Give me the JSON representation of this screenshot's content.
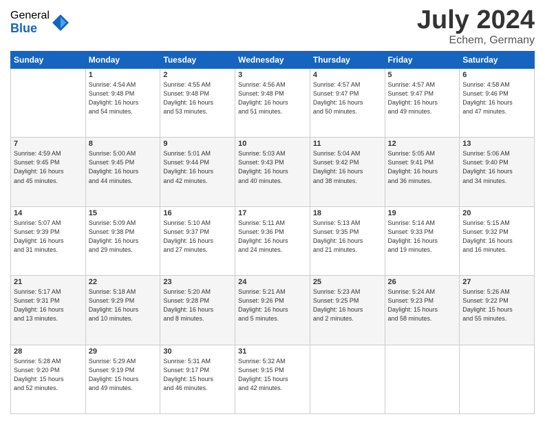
{
  "logo": {
    "general": "General",
    "blue": "Blue"
  },
  "title": {
    "month_year": "July 2024",
    "location": "Echem, Germany"
  },
  "headers": [
    "Sunday",
    "Monday",
    "Tuesday",
    "Wednesday",
    "Thursday",
    "Friday",
    "Saturday"
  ],
  "weeks": [
    [
      {
        "day": "",
        "info": ""
      },
      {
        "day": "1",
        "info": "Sunrise: 4:54 AM\nSunset: 9:48 PM\nDaylight: 16 hours\nand 54 minutes."
      },
      {
        "day": "2",
        "info": "Sunrise: 4:55 AM\nSunset: 9:48 PM\nDaylight: 16 hours\nand 53 minutes."
      },
      {
        "day": "3",
        "info": "Sunrise: 4:56 AM\nSunset: 9:48 PM\nDaylight: 16 hours\nand 51 minutes."
      },
      {
        "day": "4",
        "info": "Sunrise: 4:57 AM\nSunset: 9:47 PM\nDaylight: 16 hours\nand 50 minutes."
      },
      {
        "day": "5",
        "info": "Sunrise: 4:57 AM\nSunset: 9:47 PM\nDaylight: 16 hours\nand 49 minutes."
      },
      {
        "day": "6",
        "info": "Sunrise: 4:58 AM\nSunset: 9:46 PM\nDaylight: 16 hours\nand 47 minutes."
      }
    ],
    [
      {
        "day": "7",
        "info": "Sunrise: 4:59 AM\nSunset: 9:45 PM\nDaylight: 16 hours\nand 45 minutes."
      },
      {
        "day": "8",
        "info": "Sunrise: 5:00 AM\nSunset: 9:45 PM\nDaylight: 16 hours\nand 44 minutes."
      },
      {
        "day": "9",
        "info": "Sunrise: 5:01 AM\nSunset: 9:44 PM\nDaylight: 16 hours\nand 42 minutes."
      },
      {
        "day": "10",
        "info": "Sunrise: 5:03 AM\nSunset: 9:43 PM\nDaylight: 16 hours\nand 40 minutes."
      },
      {
        "day": "11",
        "info": "Sunrise: 5:04 AM\nSunset: 9:42 PM\nDaylight: 16 hours\nand 38 minutes."
      },
      {
        "day": "12",
        "info": "Sunrise: 5:05 AM\nSunset: 9:41 PM\nDaylight: 16 hours\nand 36 minutes."
      },
      {
        "day": "13",
        "info": "Sunrise: 5:06 AM\nSunset: 9:40 PM\nDaylight: 16 hours\nand 34 minutes."
      }
    ],
    [
      {
        "day": "14",
        "info": "Sunrise: 5:07 AM\nSunset: 9:39 PM\nDaylight: 16 hours\nand 31 minutes."
      },
      {
        "day": "15",
        "info": "Sunrise: 5:09 AM\nSunset: 9:38 PM\nDaylight: 16 hours\nand 29 minutes."
      },
      {
        "day": "16",
        "info": "Sunrise: 5:10 AM\nSunset: 9:37 PM\nDaylight: 16 hours\nand 27 minutes."
      },
      {
        "day": "17",
        "info": "Sunrise: 5:11 AM\nSunset: 9:36 PM\nDaylight: 16 hours\nand 24 minutes."
      },
      {
        "day": "18",
        "info": "Sunrise: 5:13 AM\nSunset: 9:35 PM\nDaylight: 16 hours\nand 21 minutes."
      },
      {
        "day": "19",
        "info": "Sunrise: 5:14 AM\nSunset: 9:33 PM\nDaylight: 16 hours\nand 19 minutes."
      },
      {
        "day": "20",
        "info": "Sunrise: 5:15 AM\nSunset: 9:32 PM\nDaylight: 16 hours\nand 16 minutes."
      }
    ],
    [
      {
        "day": "21",
        "info": "Sunrise: 5:17 AM\nSunset: 9:31 PM\nDaylight: 16 hours\nand 13 minutes."
      },
      {
        "day": "22",
        "info": "Sunrise: 5:18 AM\nSunset: 9:29 PM\nDaylight: 16 hours\nand 10 minutes."
      },
      {
        "day": "23",
        "info": "Sunrise: 5:20 AM\nSunset: 9:28 PM\nDaylight: 16 hours\nand 8 minutes."
      },
      {
        "day": "24",
        "info": "Sunrise: 5:21 AM\nSunset: 9:26 PM\nDaylight: 16 hours\nand 5 minutes."
      },
      {
        "day": "25",
        "info": "Sunrise: 5:23 AM\nSunset: 9:25 PM\nDaylight: 16 hours\nand 2 minutes."
      },
      {
        "day": "26",
        "info": "Sunrise: 5:24 AM\nSunset: 9:23 PM\nDaylight: 15 hours\nand 58 minutes."
      },
      {
        "day": "27",
        "info": "Sunrise: 5:26 AM\nSunset: 9:22 PM\nDaylight: 15 hours\nand 55 minutes."
      }
    ],
    [
      {
        "day": "28",
        "info": "Sunrise: 5:28 AM\nSunset: 9:20 PM\nDaylight: 15 hours\nand 52 minutes."
      },
      {
        "day": "29",
        "info": "Sunrise: 5:29 AM\nSunset: 9:19 PM\nDaylight: 15 hours\nand 49 minutes."
      },
      {
        "day": "30",
        "info": "Sunrise: 5:31 AM\nSunset: 9:17 PM\nDaylight: 15 hours\nand 46 minutes."
      },
      {
        "day": "31",
        "info": "Sunrise: 5:32 AM\nSunset: 9:15 PM\nDaylight: 15 hours\nand 42 minutes."
      },
      {
        "day": "",
        "info": ""
      },
      {
        "day": "",
        "info": ""
      },
      {
        "day": "",
        "info": ""
      }
    ]
  ]
}
